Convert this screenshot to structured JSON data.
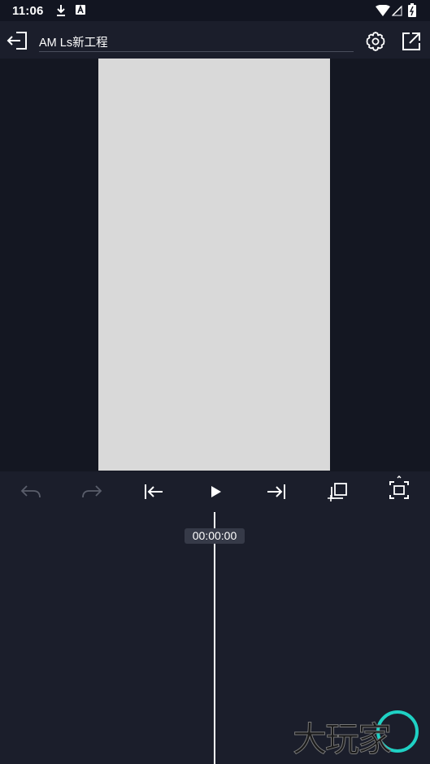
{
  "status_bar": {
    "time": "11:06",
    "icons": [
      "download-icon",
      "a-badge-icon",
      "wifi-icon",
      "signal-icon",
      "battery-icon"
    ]
  },
  "top_bar": {
    "project_title": "AM Ls新工程",
    "icons": [
      "exit-icon",
      "settings-icon",
      "export-icon"
    ]
  },
  "controls": {
    "icons": [
      "undo-icon",
      "redo-icon",
      "jump-to-start-icon",
      "play-icon",
      "jump-to-end-icon",
      "add-layer-icon",
      "fit-screen-icon"
    ]
  },
  "timeline": {
    "timecode": "00:00:00"
  },
  "watermark": {
    "text": "大玩家"
  },
  "colors": {
    "background": "#141722",
    "panel": "#1b1e2b",
    "canvas": "#d9d9d9",
    "disabled_icon": "#5a5e6b",
    "timecode_bg": "#363a48"
  }
}
